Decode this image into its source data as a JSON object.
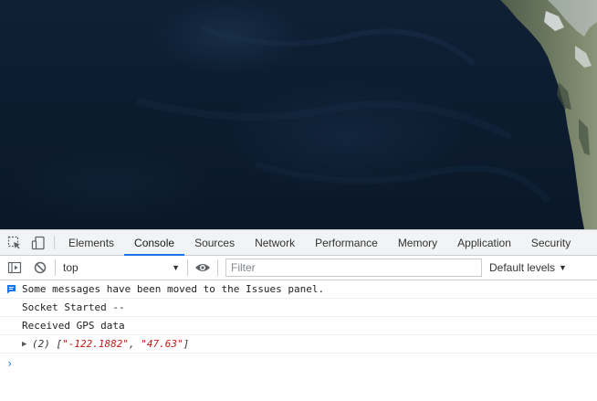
{
  "devtools": {
    "tabs": [
      {
        "label": "Elements",
        "active": false
      },
      {
        "label": "Console",
        "active": true
      },
      {
        "label": "Sources",
        "active": false
      },
      {
        "label": "Network",
        "active": false
      },
      {
        "label": "Performance",
        "active": false
      },
      {
        "label": "Memory",
        "active": false
      },
      {
        "label": "Application",
        "active": false
      },
      {
        "label": "Security",
        "active": false
      }
    ],
    "toolbar": {
      "context": "top",
      "filter_placeholder": "Filter",
      "levels_label": "Default levels"
    },
    "console": {
      "messages": [
        {
          "type": "info",
          "icon": "issues-message-icon",
          "text": "Some messages have been moved to the Issues panel."
        },
        {
          "type": "log",
          "text": "Socket Started --"
        },
        {
          "type": "log",
          "text": "Received GPS data"
        }
      ],
      "object": {
        "count": "(2)",
        "open": "[",
        "values": [
          "\"-122.1882\"",
          "\"47.63\""
        ],
        "separator": ", ",
        "close": "]"
      }
    },
    "colors": {
      "accent": "#1a73e8",
      "string": "#c41a16",
      "panel_bg": "#f1f3f4"
    }
  },
  "map": {
    "type": "satellite-imagery",
    "colors": {
      "ocean": "#0c1b2e",
      "land": "#5c6b52",
      "snow": "#e8ecef"
    }
  }
}
